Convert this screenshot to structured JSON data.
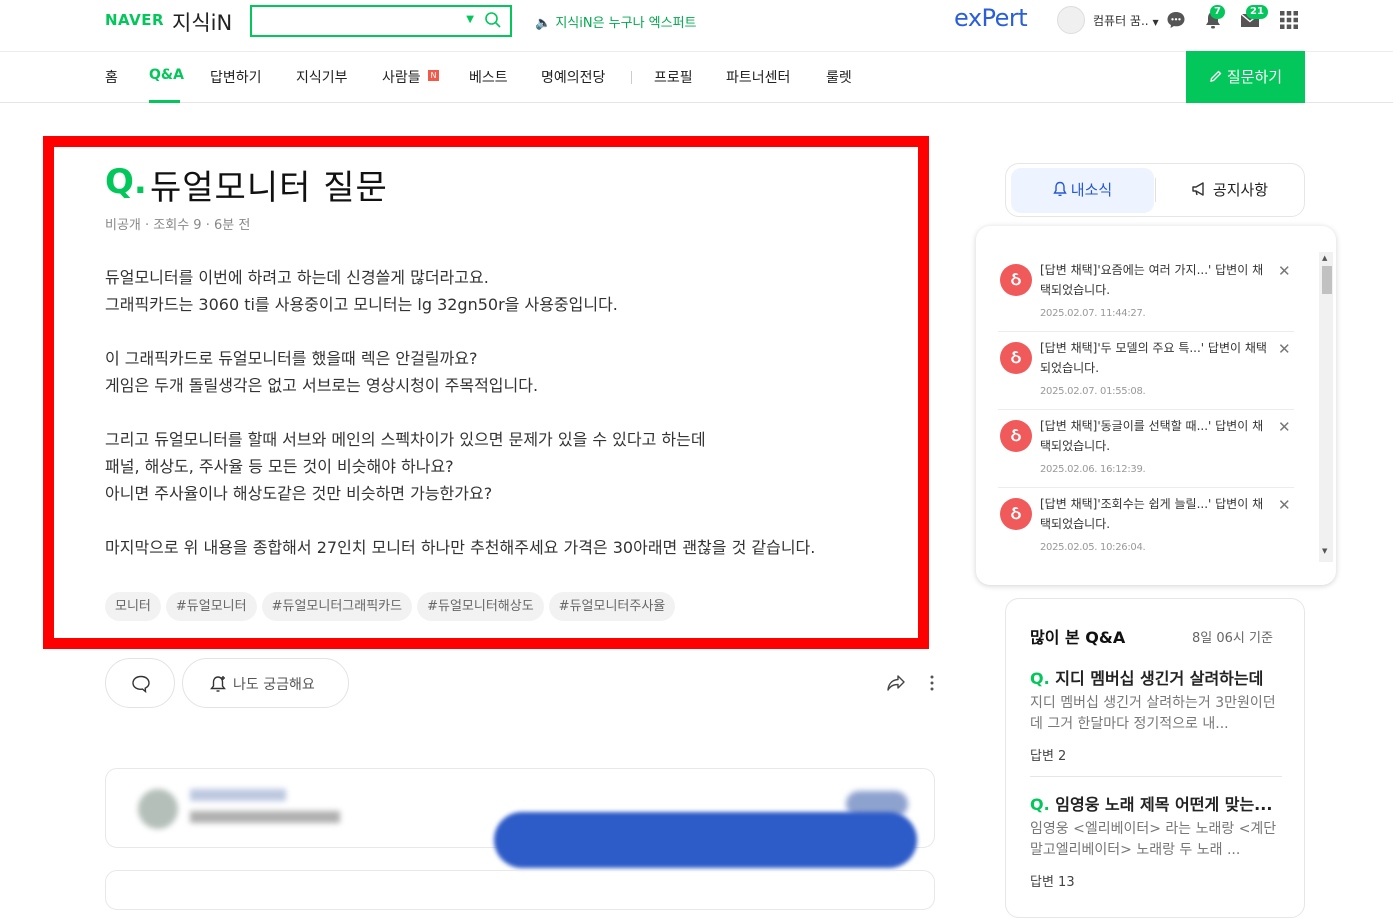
{
  "header": {
    "logo_naver": "NAVER",
    "logo_jisik": "지식iN",
    "promo": "🔈 지식iN은 누구나 엑스퍼트",
    "expert": "exPert",
    "user_name": "컴퓨터 꿈..",
    "notification_count": "7",
    "mail_count": "21"
  },
  "nav": {
    "items": [
      "홈",
      "Q&A",
      "답변하기",
      "지식기부",
      "사람들",
      "베스트",
      "명예의전당",
      "프로필",
      "파트너센터",
      "룰렛"
    ],
    "new_badge": "N",
    "ask_button": "질문하기"
  },
  "question": {
    "q_mark": "Q.",
    "title": "듀얼모니터 질문",
    "meta": "비공개 · 조회수 9 · 6분 전",
    "body_lines": [
      "듀얼모니터를 이번에 하려고 하는데 신경쓸게 많더라고요.",
      "그래픽카드는 3060 ti를 사용중이고 모니터는 lg 32gn50r을 사용중입니다.",
      "",
      "이 그래픽카드로 듀얼모니터를 했을때 렉은 안걸릴까요?",
      "게임은 두개 돌릴생각은 없고 서브로는 영상시청이 주목적입니다.",
      "",
      "그리고 듀얼모니터를 할때 서브와 메인의 스펙차이가 있으면 문제가 있을 수 있다고 하는데",
      "패널, 해상도, 주사율 등 모든 것이 비슷해야 하나요?",
      "아니면 주사율이나 해상도같은 것만 비슷하면 가능한가요?",
      "",
      "마지막으로 위 내용을 종합해서 27인치 모니터 하나만 추천해주세요 가격은 30아래면 괜찮을 것 같습니다."
    ],
    "tags": [
      "모니터",
      "#듀얼모니터",
      "#듀얼모니터그래픽카드",
      "#듀얼모니터해상도",
      "#듀얼모니터주사율"
    ],
    "curious_button": "나도 궁금해요"
  },
  "sidebar": {
    "tab_news": "내소식",
    "tab_notice": "공지사항",
    "notifications": [
      {
        "text": "[답변 채택]'요즘에는 여러 가지...' 답변이 채택되었습니다.",
        "time": "2025.02.07. 11:44:27."
      },
      {
        "text": "[답변 채택]'두 모델의 주요 특...' 답변이 채택되었습니다.",
        "time": "2025.02.07. 01:55:08."
      },
      {
        "text": "[답변 채택]'동글이를 선택할 때...' 답변이 채택되었습니다.",
        "time": "2025.02.06. 16:12:39."
      },
      {
        "text": "[답변 채택]'조회수는 쉽게 늘릴...' 답변이 채택되었습니다.",
        "time": "2025.02.05. 10:26:04."
      }
    ],
    "popular": {
      "title": "많이 본 Q&A",
      "date": "8일 06시 기준",
      "items": [
        {
          "q": "Q.",
          "title": "지디 멤버십 생긴거 살려하는데",
          "desc": "지디 멤버십 생긴거 살려하는거 3만원이던데 그거 한달마다 정기적으로 내...",
          "answers": "답변 2"
        },
        {
          "q": "Q.",
          "title": "임영웅 노래 제목 어떤게 맞는...",
          "desc": "임영웅 <엘리베이터> 라는 노래랑 <계단말고엘리베이터> 노래랑 두 노래 ...",
          "answers": "답변 13"
        }
      ]
    }
  }
}
